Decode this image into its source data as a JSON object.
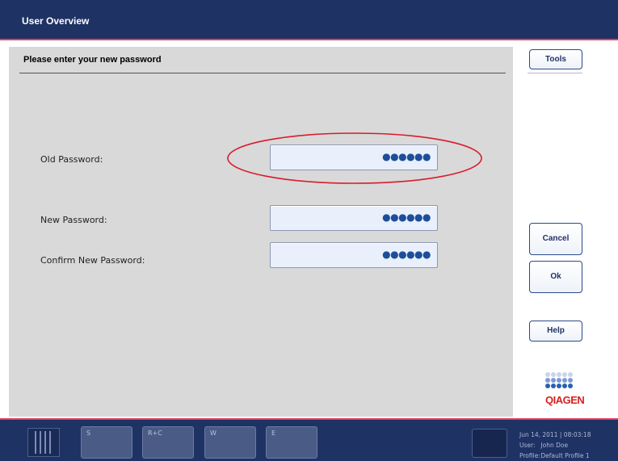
{
  "header": {
    "title": "User Overview"
  },
  "main": {
    "title": "Please enter your new password",
    "fields": [
      {
        "label": "Old Password:",
        "value": "●●●●●●"
      },
      {
        "label": "New Password:",
        "value": "●●●●●●"
      },
      {
        "label": "Confirm New Password:",
        "value": "●●●●●●"
      }
    ]
  },
  "sidebar": {
    "tools_label": "Tools",
    "cancel_label": "Cancel",
    "ok_label": "Ok",
    "help_label": "Help",
    "logo_text": "QIAGEN"
  },
  "footer": {
    "slots": [
      "S",
      "R+C",
      "W",
      "E"
    ],
    "datetime": "Jun 14, 2011 | 08:03:18",
    "user_key": "User:",
    "user_value": "John Doe",
    "profile_key": "Profile:",
    "profile_value": "Default Profile 1"
  },
  "colors": {
    "header_bg": "#1e3264",
    "accent_stripe": "#e04060",
    "panel_bg": "#d9d9d9",
    "input_bg": "#e9f0fc",
    "highlight_ellipse": "#d81c2c",
    "logo_red": "#d82020",
    "logo_blue": "#2b5fb0"
  }
}
